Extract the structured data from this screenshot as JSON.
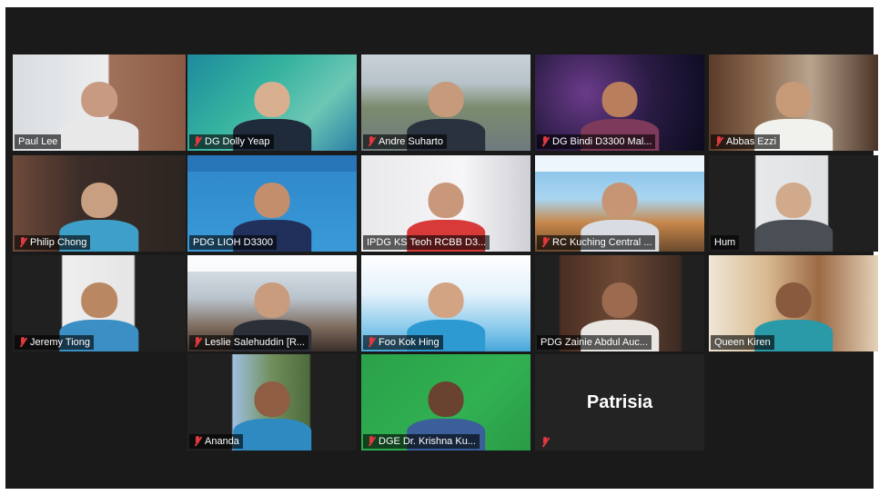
{
  "meeting": {
    "participants": [
      {
        "name": "Paul Lee",
        "muted": false,
        "active_speaker": true
      },
      {
        "name": "DG Dolly Yeap",
        "muted": true
      },
      {
        "name": "Andre Suharto",
        "muted": true
      },
      {
        "name": "DG Bindi D3300 Mal...",
        "muted": true
      },
      {
        "name": "Abbas Ezzi",
        "muted": true
      },
      {
        "name": "Philip Chong",
        "muted": true
      },
      {
        "name": "PDG LIOH D3300",
        "muted": false
      },
      {
        "name": "IPDG KS Teoh RCBB D3...",
        "muted": false
      },
      {
        "name": "RC Kuching Central ...",
        "muted": true
      },
      {
        "name": "Hum",
        "muted": false
      },
      {
        "name": "Jeremy Tiong",
        "muted": true
      },
      {
        "name": "Leslie Salehuddin [R...",
        "muted": true
      },
      {
        "name": "Foo Kok Hing",
        "muted": true
      },
      {
        "name": "PDG  Zainie Abdul Auc...",
        "muted": false
      },
      {
        "name": "Queen Kiren",
        "muted": false
      },
      {
        "name": "Ananda",
        "muted": true
      },
      {
        "name": "DGE Dr. Krishna Ku...",
        "muted": true
      },
      {
        "name": "Patrisia",
        "muted": true,
        "video_off": true
      }
    ]
  },
  "colors": {
    "active_border": "#d5e05a",
    "muted_icon": "#e0383e",
    "gallery_bg": "#1a1a1a"
  }
}
